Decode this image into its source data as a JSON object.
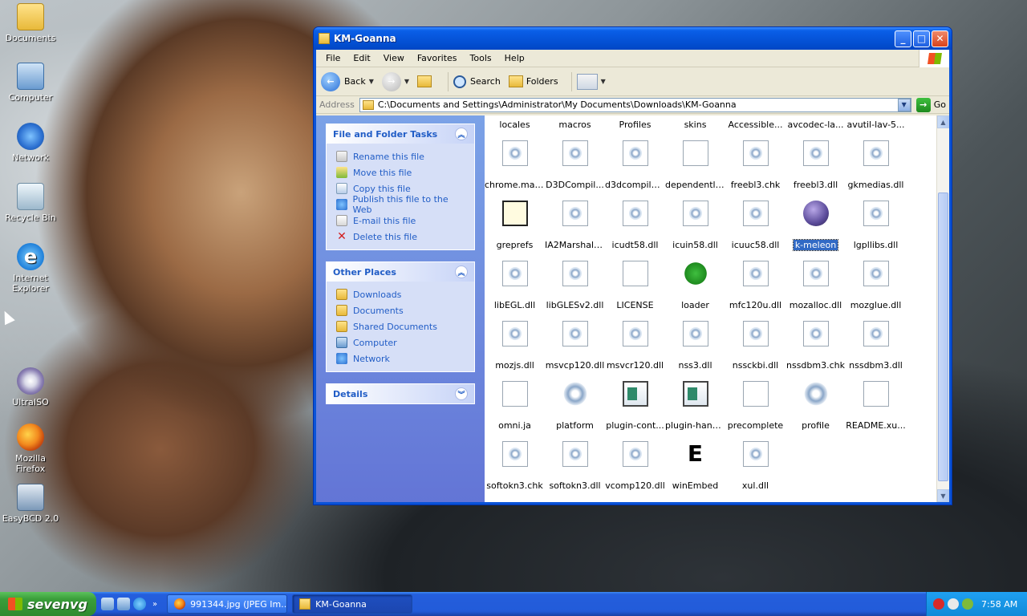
{
  "desktop": {
    "icons": [
      {
        "label": "Documents",
        "icon": "folder-icon"
      },
      {
        "label": "Computer",
        "icon": "computer-icon"
      },
      {
        "label": "Network",
        "icon": "network-icon"
      },
      {
        "label": "Recycle Bin",
        "icon": "recycle-bin-icon"
      },
      {
        "label": "Internet Explorer",
        "icon": "ie-icon"
      },
      {
        "label": "UltraISO",
        "icon": "ultraiso-icon"
      },
      {
        "label": "Mozilla Firefox",
        "icon": "firefox-icon"
      },
      {
        "label": "EasyBCD 2.0",
        "icon": "easybcd-icon"
      }
    ]
  },
  "window": {
    "title": "KM-Goanna",
    "menu": [
      "File",
      "Edit",
      "View",
      "Favorites",
      "Tools",
      "Help"
    ],
    "toolbar": {
      "back": "Back",
      "search": "Search",
      "folders": "Folders"
    },
    "address": {
      "label": "Address",
      "value": "C:\\Documents and Settings\\Administrator\\My Documents\\Downloads\\KM-Goanna",
      "go": "Go"
    }
  },
  "taskpane": {
    "file_tasks": {
      "title": "File and Folder Tasks",
      "items": [
        "Rename this file",
        "Move this file",
        "Copy this file",
        "Publish this file to the Web",
        "E-mail this file",
        "Delete this file"
      ]
    },
    "other_places": {
      "title": "Other Places",
      "items": [
        "Downloads",
        "Documents",
        "Shared Documents",
        "Computer",
        "Network"
      ]
    },
    "details": {
      "title": "Details"
    }
  },
  "files": [
    [
      {
        "name": "locales",
        "icon": "folder"
      },
      {
        "name": "macros",
        "icon": "folder"
      },
      {
        "name": "Profiles",
        "icon": "folder"
      },
      {
        "name": "skins",
        "icon": "folder"
      },
      {
        "name": "Accessible...",
        "icon": "dll"
      },
      {
        "name": "avcodec-la...",
        "icon": "dll"
      },
      {
        "name": "avutil-lav-5...",
        "icon": "dll"
      }
    ],
    [
      {
        "name": "chrome.man...",
        "icon": "dll"
      },
      {
        "name": "D3DCompil...",
        "icon": "dll"
      },
      {
        "name": "d3dcompiler...",
        "icon": "dll"
      },
      {
        "name": "dependentli...",
        "icon": "doc"
      },
      {
        "name": "freebl3.chk",
        "icon": "dll"
      },
      {
        "name": "freebl3.dll",
        "icon": "dll"
      },
      {
        "name": "gkmedias.dll",
        "icon": "dll"
      }
    ],
    [
      {
        "name": "greprefs",
        "icon": "script"
      },
      {
        "name": "IA2Marshal.dll",
        "icon": "dll"
      },
      {
        "name": "icudt58.dll",
        "icon": "dll"
      },
      {
        "name": "icuin58.dll",
        "icon": "dll"
      },
      {
        "name": "icuuc58.dll",
        "icon": "dll"
      },
      {
        "name": "k-meleon",
        "icon": "kmeleon",
        "selected": true
      },
      {
        "name": "lgpllibs.dll",
        "icon": "dll"
      }
    ],
    [
      {
        "name": "libEGL.dll",
        "icon": "dll"
      },
      {
        "name": "libGLESv2.dll",
        "icon": "dll"
      },
      {
        "name": "LICENSE",
        "icon": "doc"
      },
      {
        "name": "loader",
        "icon": "loader"
      },
      {
        "name": "mfc120u.dll",
        "icon": "dll"
      },
      {
        "name": "mozalloc.dll",
        "icon": "dll"
      },
      {
        "name": "mozglue.dll",
        "icon": "dll"
      }
    ],
    [
      {
        "name": "mozjs.dll",
        "icon": "dll"
      },
      {
        "name": "msvcp120.dll",
        "icon": "dll"
      },
      {
        "name": "msvcr120.dll",
        "icon": "dll"
      },
      {
        "name": "nss3.dll",
        "icon": "dll"
      },
      {
        "name": "nssckbi.dll",
        "icon": "dll"
      },
      {
        "name": "nssdbm3.chk",
        "icon": "dll"
      },
      {
        "name": "nssdbm3.dll",
        "icon": "dll"
      }
    ],
    [
      {
        "name": "omni.ja",
        "icon": "doc"
      },
      {
        "name": "platform",
        "icon": "gear"
      },
      {
        "name": "plugin-cont...",
        "icon": "app"
      },
      {
        "name": "plugin-hang-ui",
        "icon": "app"
      },
      {
        "name": "precomplete",
        "icon": "doc"
      },
      {
        "name": "profile",
        "icon": "gear"
      },
      {
        "name": "README.xu...",
        "icon": "doc"
      }
    ],
    [
      {
        "name": "softokn3.chk",
        "icon": "dll"
      },
      {
        "name": "softokn3.dll",
        "icon": "dll"
      },
      {
        "name": "vcomp120.dll",
        "icon": "dll"
      },
      {
        "name": "winEmbed",
        "icon": "e",
        "glyph": "E"
      },
      {
        "name": "xul.dll",
        "icon": "dll"
      }
    ]
  ],
  "taskbar": {
    "start": "sevenvg",
    "buttons": [
      {
        "label": "991344.jpg (JPEG Im...",
        "icon": "firefox-icon"
      },
      {
        "label": "KM-Goanna",
        "icon": "folder-icon",
        "active": true
      }
    ],
    "clock": "7:58 AM"
  }
}
